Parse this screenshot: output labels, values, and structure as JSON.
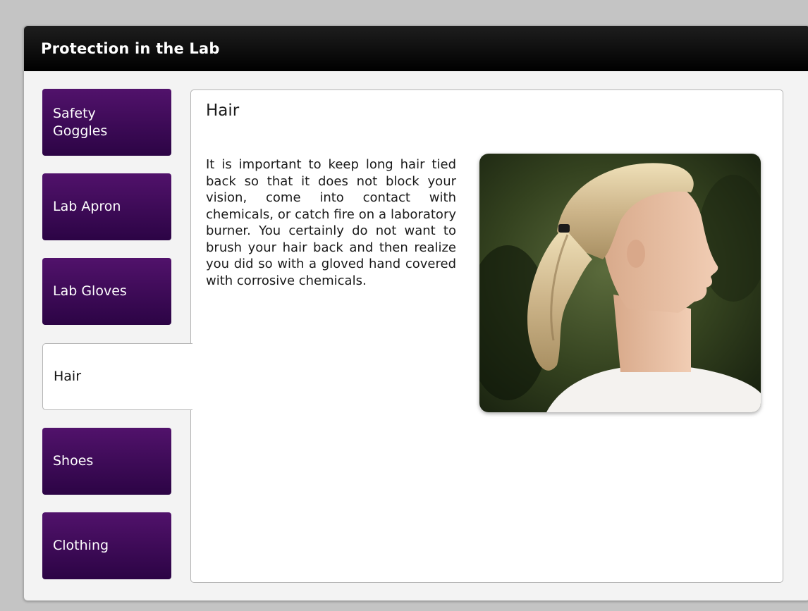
{
  "window": {
    "title": "Protection in the Lab"
  },
  "tabs": [
    {
      "label": "Safety\nGoggles",
      "active": false
    },
    {
      "label": "Lab Apron",
      "active": false
    },
    {
      "label": "Lab Gloves",
      "active": false
    },
    {
      "label": "Hair",
      "active": true
    },
    {
      "label": "Shoes",
      "active": false
    },
    {
      "label": "Clothing",
      "active": false
    }
  ],
  "content": {
    "heading": "Hair",
    "body": "It is important to keep long hair tied back so that it does not block your vision, come into contact with chemicals, or catch fire on a laboratory burner. You certainly do not want to brush your hair back and then realize you did so with a gloved hand covered with corrosive chemicals.",
    "image_subject": "young woman with blonde hair tied back in a ponytail, profile view"
  },
  "colors": {
    "tab_purple_top": "#51126b",
    "tab_purple_bottom": "#2c0445",
    "titlebar": "#000000",
    "background": "#c4c4c4"
  }
}
